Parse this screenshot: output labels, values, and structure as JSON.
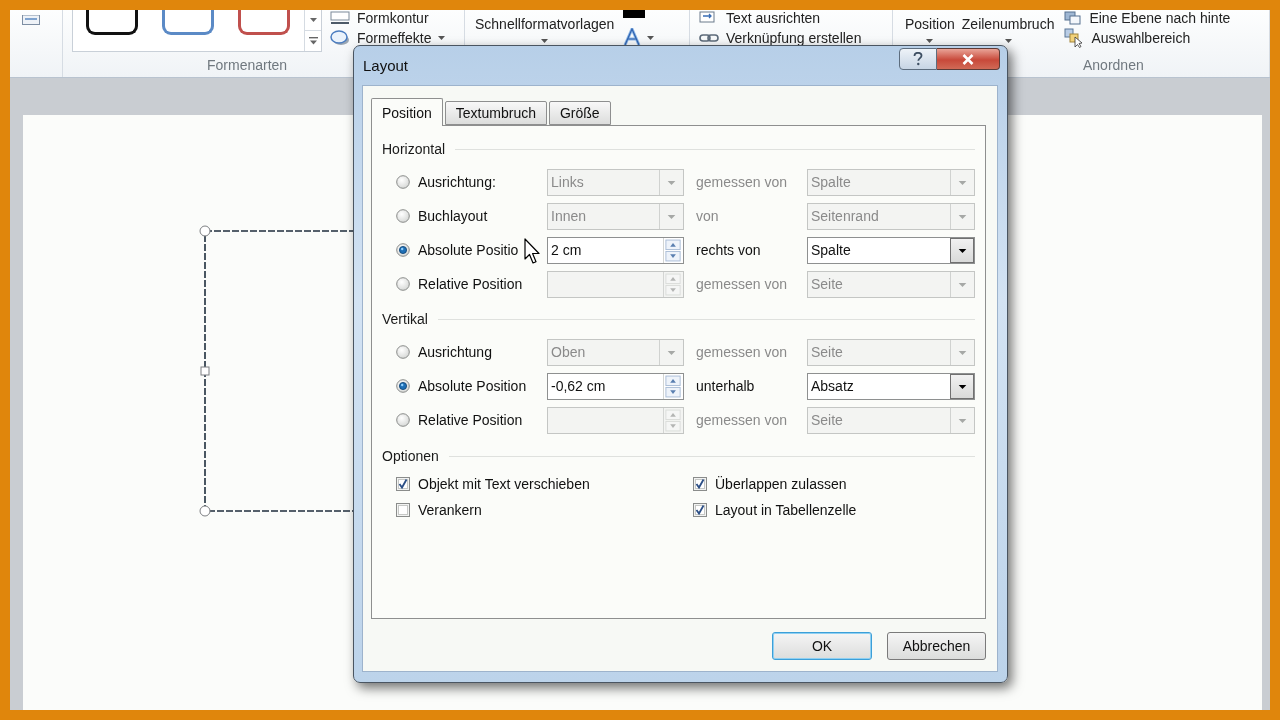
{
  "ribbon": {
    "shape_styles": {
      "label": "Formenarten",
      "styles": [
        {
          "color": "#111111"
        },
        {
          "color": "#5b8ac6"
        },
        {
          "color": "#c0504d"
        }
      ],
      "commands": [
        {
          "label": "Formkontur",
          "dropdown": false
        },
        {
          "label": "Formeffekte",
          "dropdown": true
        }
      ]
    },
    "wordart_styles": {
      "commands": [
        {
          "label": "Schnellformatvorlagen",
          "dropdown": true
        }
      ]
    },
    "text": {
      "commands": [
        {
          "label": "Text ausrichten",
          "dropdown": false
        },
        {
          "label": "Verknüpfung erstellen",
          "dropdown": false
        }
      ]
    },
    "arrange": {
      "label": "Anordnen",
      "large_commands": [
        {
          "label": "Position",
          "dropdown": true
        },
        {
          "label": "Zeilenumbruch",
          "dropdown": true
        }
      ],
      "commands": [
        {
          "label": "Eine Ebene nach hinte",
          "dropdown": false
        },
        {
          "label": "Auswahlbereich",
          "dropdown": false
        }
      ]
    }
  },
  "dialog": {
    "title": "Layout",
    "tabs": [
      {
        "label": "Position",
        "selected": true
      },
      {
        "label": "Textumbruch",
        "selected": false
      },
      {
        "label": "Größe",
        "selected": false
      }
    ],
    "sections": [
      {
        "title": "Horizontal",
        "rows": [
          {
            "label": "Ausrichtung:",
            "selected": false,
            "kind": "dropdown",
            "value": "Links",
            "relation": "gemessen von",
            "reference": "Spalte"
          },
          {
            "label": "Buchlayout",
            "selected": false,
            "kind": "dropdown",
            "value": "Innen",
            "relation": "von",
            "reference": "Seitenrand"
          },
          {
            "label": "Absolute Positio",
            "selected": true,
            "kind": "spin",
            "value": "2 cm",
            "relation": "rechts von",
            "reference": "Spalte"
          },
          {
            "label": "Relative Position",
            "selected": false,
            "kind": "spin",
            "relation": "gemessen von",
            "reference": "Seite"
          }
        ]
      },
      {
        "title": "Vertikal",
        "rows": [
          {
            "label": "Ausrichtung",
            "selected": false,
            "kind": "dropdown",
            "value": "Oben",
            "relation": "gemessen von",
            "reference": "Seite"
          },
          {
            "label": "Absolute Position",
            "selected": true,
            "kind": "spin",
            "value": "-0,62 cm",
            "relation": "unterhalb",
            "reference": "Absatz"
          },
          {
            "label": "Relative Position",
            "selected": false,
            "kind": "spin",
            "relation": "gemessen von",
            "reference": "Seite"
          }
        ]
      }
    ],
    "options": {
      "title": "Optionen",
      "checkboxes": [
        {
          "label": "Objekt mit Text verschieben",
          "checked": true
        },
        {
          "label": "Überlappen zulassen",
          "checked": true
        },
        {
          "label": "Verankern",
          "checked": false
        },
        {
          "label": "Layout in Tabellenzelle",
          "checked": true
        }
      ]
    },
    "buttons": [
      {
        "label": "OK",
        "default": true
      },
      {
        "label": "Abbrechen",
        "default": false
      }
    ]
  }
}
